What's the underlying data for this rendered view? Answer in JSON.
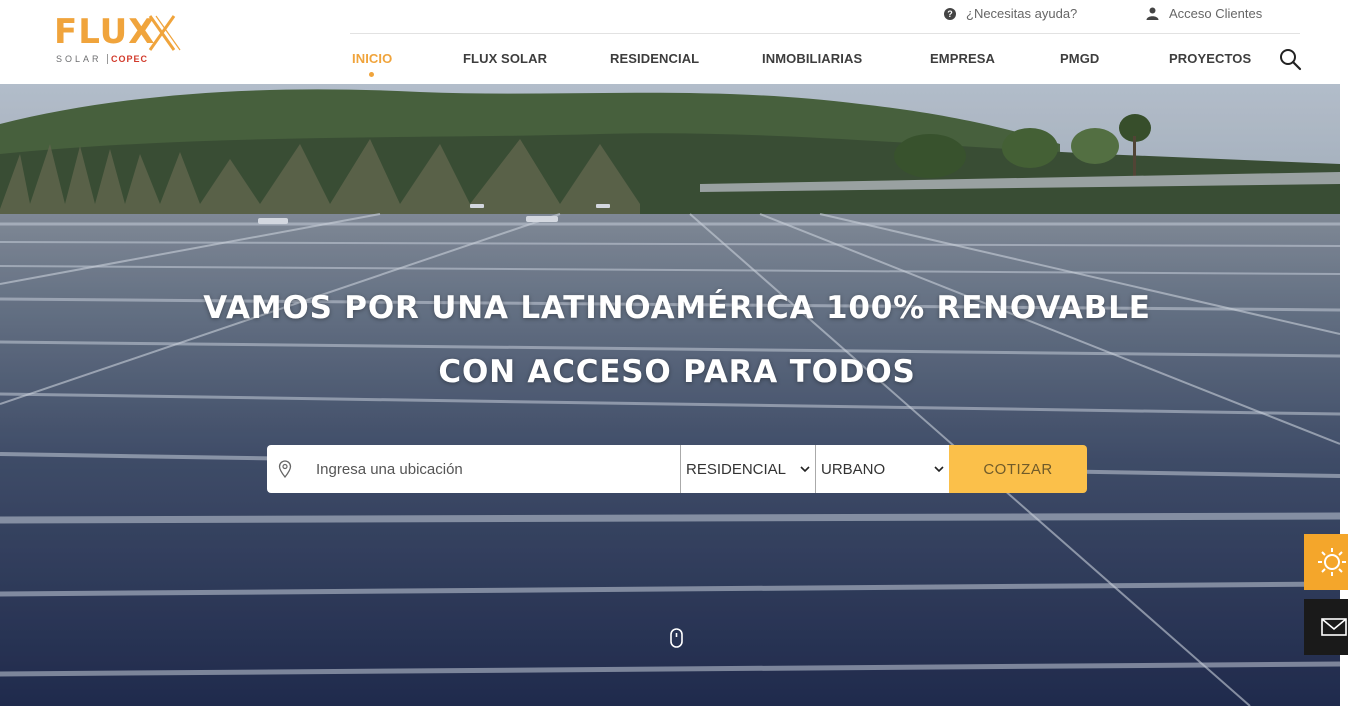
{
  "brand": {
    "name": "FLUX",
    "sub_left": "SOLAR",
    "sub_right": "COPEC",
    "accent_color": "#f0a43c"
  },
  "topbar": {
    "help_label": "¿Necesitas ayuda?",
    "help_icon": "question-circle-icon",
    "clients_label": "Acceso Clientes",
    "clients_icon": "user-icon"
  },
  "nav": {
    "items": [
      {
        "label": "INICIO",
        "active": true
      },
      {
        "label": "FLUX SOLAR",
        "active": false
      },
      {
        "label": "RESIDENCIAL",
        "active": false
      },
      {
        "label": "INMOBILIARIAS",
        "active": false
      },
      {
        "label": "EMPRESA",
        "active": false
      },
      {
        "label": "PMGD",
        "active": false
      },
      {
        "label": "PROYECTOS",
        "active": false
      }
    ],
    "search_icon": "search-icon"
  },
  "hero": {
    "title_line1": "VAMOS POR UNA LATINOAMÉRICA 100% RENOVABLE",
    "title_line2": "CON ACCESO PARA TODOS",
    "location_placeholder": "Ingresa una ubicación",
    "location_icon": "map-pin-icon",
    "type_select": {
      "selected": "RESIDENCIAL"
    },
    "zone_select": {
      "selected": "URBANO"
    },
    "submit_label": "COTIZAR",
    "submit_color": "#fbc04a",
    "scroll_icon": "mouse-scroll-icon"
  },
  "side_buttons": {
    "sun_icon": "sun-icon",
    "sun_color": "#f4a62b",
    "mail_icon": "mail-icon",
    "mail_color": "#1a1a1a"
  }
}
